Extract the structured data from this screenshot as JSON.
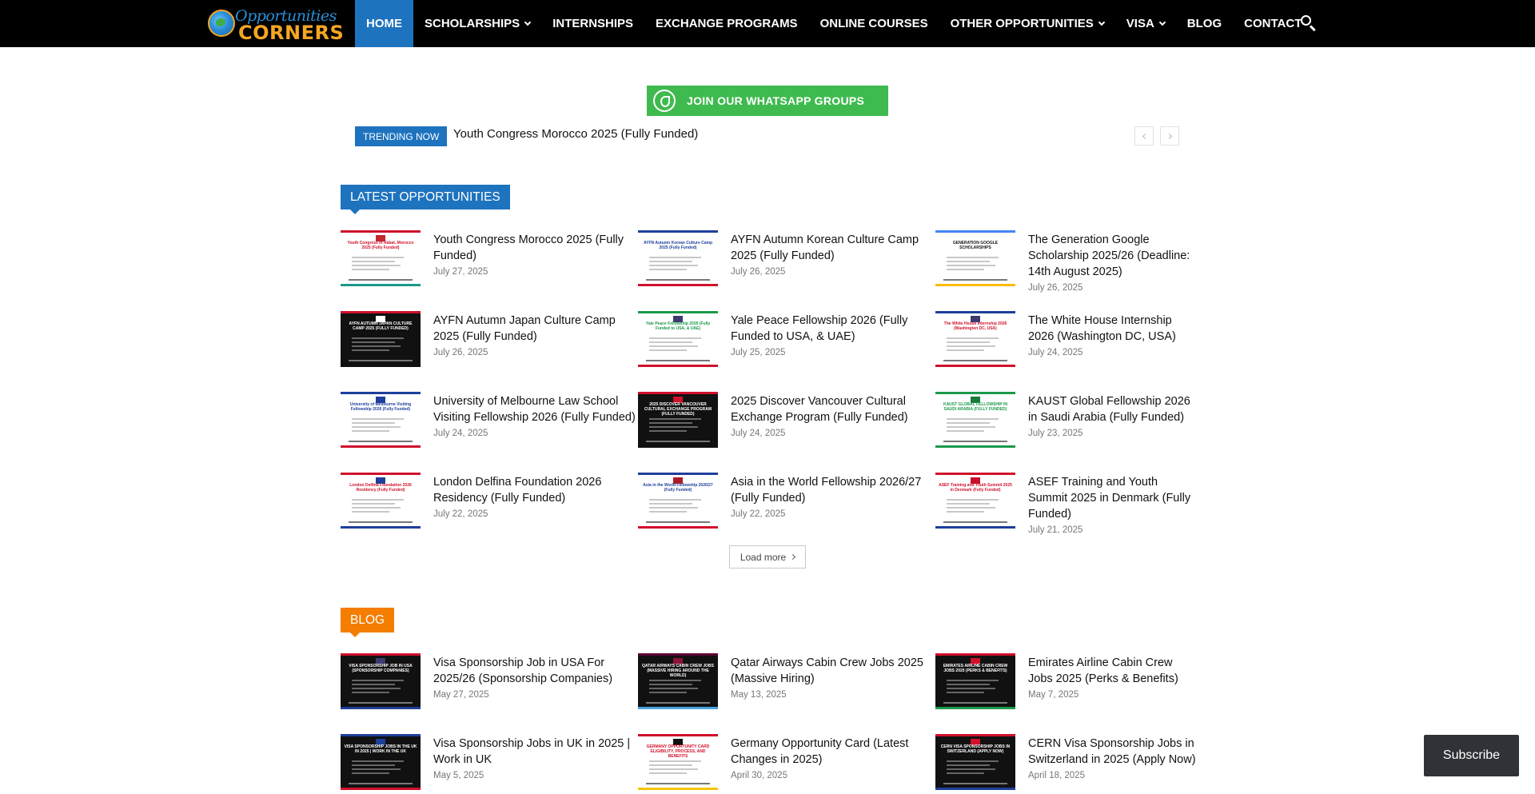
{
  "header": {
    "logo_line1": "Opportunities",
    "logo_line2": "CORNERS",
    "nav": [
      {
        "label": "HOME",
        "active": true,
        "dropdown": false
      },
      {
        "label": "SCHOLARSHIPS",
        "active": false,
        "dropdown": true
      },
      {
        "label": "INTERNSHIPS",
        "active": false,
        "dropdown": false
      },
      {
        "label": "EXCHANGE PROGRAMS",
        "active": false,
        "dropdown": false
      },
      {
        "label": "ONLINE COURSES",
        "active": false,
        "dropdown": false
      },
      {
        "label": "OTHER OPPORTUNITIES",
        "active": false,
        "dropdown": true
      },
      {
        "label": "VISA",
        "active": false,
        "dropdown": true
      },
      {
        "label": "BLOG",
        "active": false,
        "dropdown": false
      },
      {
        "label": "CONTACT",
        "active": false,
        "dropdown": false
      }
    ]
  },
  "whatsapp": {
    "label": "JOIN OUR WHATSAPP GROUPS",
    "color": "#3fba4f"
  },
  "trending": {
    "label": "TRENDING NOW",
    "text": "Youth Congress Morocco 2025 (Fully Funded)"
  },
  "latest": {
    "title": "LATEST OPPORTUNITIES",
    "color": "#1e73be",
    "posts": [
      {
        "title": "Youth Congress Morocco 2025 (Fully Funded)",
        "date": "July 27, 2025",
        "thumb_title": "Youth Congress in Rabat, Morocco 2025 (Fully Funded)",
        "top": "#d0112b",
        "bot": "#1a9a8a",
        "tc": "#d0112b",
        "fc": "#c1272d",
        "dark": false
      },
      {
        "title": "AYFN Autumn Korean Culture Camp 2025 (Fully Funded)",
        "date": "July 26, 2025",
        "thumb_title": "AYFN Autumn Korean Culture Camp 2025 (Fully Funded)",
        "top": "#1e3f9a",
        "bot": "#d0112b",
        "tc": "#1e3f9a",
        "fc": "#ffffff",
        "dark": false
      },
      {
        "title": "The Generation Google Scholarship 2025/26 (Deadline: 14th August 2025)",
        "date": "July 26, 2025",
        "thumb_title": "GENERATION GOOGLE SCHOLARSHIPS",
        "top": "#4285f4",
        "bot": "#fbbc05",
        "tc": "#111111",
        "fc": "#ffffff",
        "dark": false
      },
      {
        "title": "AYFN Autumn Japan Culture Camp 2025 (Fully Funded)",
        "date": "July 26, 2025",
        "thumb_title": "AYFN AUTUMN JAPAN CULTURE CAMP 2025 (FULLY FUNDED)",
        "top": "#d0112b",
        "bot": "#111111",
        "tc": "#ffffff",
        "fc": "#ffffff",
        "dark": true
      },
      {
        "title": "Yale Peace Fellowship 2026 (Fully Funded to USA, & UAE)",
        "date": "July 25, 2025",
        "thumb_title": "Yale Peace Fellowship 2026 (Fully Funded to USA, & UAE)",
        "top": "#1a9a4a",
        "bot": "#d0112b",
        "tc": "#1a9a4a",
        "fc": "#3c3b6e",
        "dark": false
      },
      {
        "title": "The White House Internship 2026 (Washington DC, USA)",
        "date": "July 24, 2025",
        "thumb_title": "The White House Internship 2026 (Washington DC, USA)",
        "top": "#1e3f9a",
        "bot": "#d0112b",
        "tc": "#d0112b",
        "fc": "#3c3b6e",
        "dark": false
      },
      {
        "title": "University of Melbourne Law School Visiting Fellowship 2026 (Fully Funded)",
        "date": "July 24, 2025",
        "thumb_title": "University of Melbourne Visiting Fellowship 2026 (Fully Funded)",
        "top": "#1e3f9a",
        "bot": "#d0112b",
        "tc": "#1e3f9a",
        "fc": "#1e3f9a",
        "dark": false
      },
      {
        "title": "2025 Discover Vancouver Cultural Exchange Program (Fully Funded)",
        "date": "July 24, 2025",
        "thumb_title": "2025 DISCOVER VANCOUVER CULTURAL EXCHANGE PROGRAM (FULLY FUNDED)",
        "top": "#d0112b",
        "bot": "#111111",
        "tc": "#ffffff",
        "fc": "#d0112b",
        "dark": true
      },
      {
        "title": "KAUST Global Fellowship 2026 in Saudi Arabia (Fully Funded)",
        "date": "July 23, 2025",
        "thumb_title": "KAUST GLOBAL FELLOWSHIP IN SAUDI ARABIA (FULLY FUNDED)",
        "top": "#1a9a4a",
        "bot": "#1a9a4a",
        "tc": "#1a9a4a",
        "fc": "#1a7a3a",
        "dark": false
      },
      {
        "title": "London Delfina Foundation 2026 Residency (Fully Funded)",
        "date": "July 22, 2025",
        "thumb_title": "London Delfina Foundation 2026 Residency (Fully Funded)",
        "top": "#d0112b",
        "bot": "#1e3f9a",
        "tc": "#d0112b",
        "fc": "#1e3f9a",
        "dark": false
      },
      {
        "title": "Asia in the World Fellowship 2026/27 (Fully Funded)",
        "date": "July 22, 2025",
        "thumb_title": "Asia in the World Fellowship 2026/27 (Fully Funded)",
        "top": "#1e3f9a",
        "bot": "#d0112b",
        "tc": "#1e3f9a",
        "fc": "#ae1c28",
        "dark": false
      },
      {
        "title": "ASEF Training and Youth Summit 2025 in Denmark (Fully Funded)",
        "date": "July 21, 2025",
        "thumb_title": "ASEF Training and Youth Summit 2025 in Denmark (Fully Funded)",
        "top": "#d0112b",
        "bot": "#1e3f9a",
        "tc": "#d0112b",
        "fc": "#c8102e",
        "dark": false
      }
    ],
    "load_more": "Load more"
  },
  "blog": {
    "title": "BLOG",
    "color": "#f57d00",
    "posts": [
      {
        "title": "Visa Sponsorship Job in USA For 2025/26 (Sponsorship Companies)",
        "date": "May 27, 2025",
        "thumb_title": "VISA SPONSORSHIP JOB IN USA (SPONSORSHIP COMPANIES)",
        "top": "#d0112b",
        "bot": "#1e3f9a",
        "tc": "#ffffff",
        "fc": "#3c3b6e",
        "dark": true
      },
      {
        "title": "Qatar Airways Cabin Crew Jobs 2025 (Massive Hiring)",
        "date": "May 13, 2025",
        "thumb_title": "QATAR AIRWAYS CABIN CREW JOBS (MASSIVE HIRING AROUND THE WORLD)",
        "top": "#5c0632",
        "bot": "#4aa3df",
        "tc": "#ffffff",
        "fc": "#8a1538",
        "dark": true
      },
      {
        "title": "Emirates Airline Cabin Crew Jobs 2025 (Perks & Benefits)",
        "date": "May 7, 2025",
        "thumb_title": "EMIRATES AIRLINE CABIN CREW JOBS 2025 (PERKS & BENEFITS)",
        "top": "#d0112b",
        "bot": "#1a9a4a",
        "tc": "#ffffff",
        "fc": "#d0112b",
        "dark": true
      },
      {
        "title": "Visa Sponsorship Jobs in UK in 2025 | Work in UK",
        "date": "May 5, 2025",
        "thumb_title": "VISA SPONSORSHIP JOBS IN THE UK IN 2025 | WORK IN THE UK",
        "top": "#1e3f9a",
        "bot": "#d0112b",
        "tc": "#ffffff",
        "fc": "#1e3f9a",
        "dark": true
      },
      {
        "title": "Germany Opportunity Card (Latest Changes in 2025)",
        "date": "April 30, 2025",
        "thumb_title": "GERMANY OPPORTUNITY CARD ELIGIBILITY, PROCESS, AND BENEFITS",
        "top": "#d0112b",
        "bot": "#f5c400",
        "tc": "#d0112b",
        "fc": "#111111",
        "dark": false
      },
      {
        "title": "CERN Visa Sponsorship Jobs in Switzerland in 2025 (Apply Now)",
        "date": "April 18, 2025",
        "thumb_title": "CERN VISA SPONSORSHIP JOBS IN SWITZERLAND (APPLY NOW)",
        "top": "#d0112b",
        "bot": "#1e3f9a",
        "tc": "#ffffff",
        "fc": "#d0112b",
        "dark": true
      }
    ]
  },
  "subscribe": {
    "label": "Subscribe"
  }
}
